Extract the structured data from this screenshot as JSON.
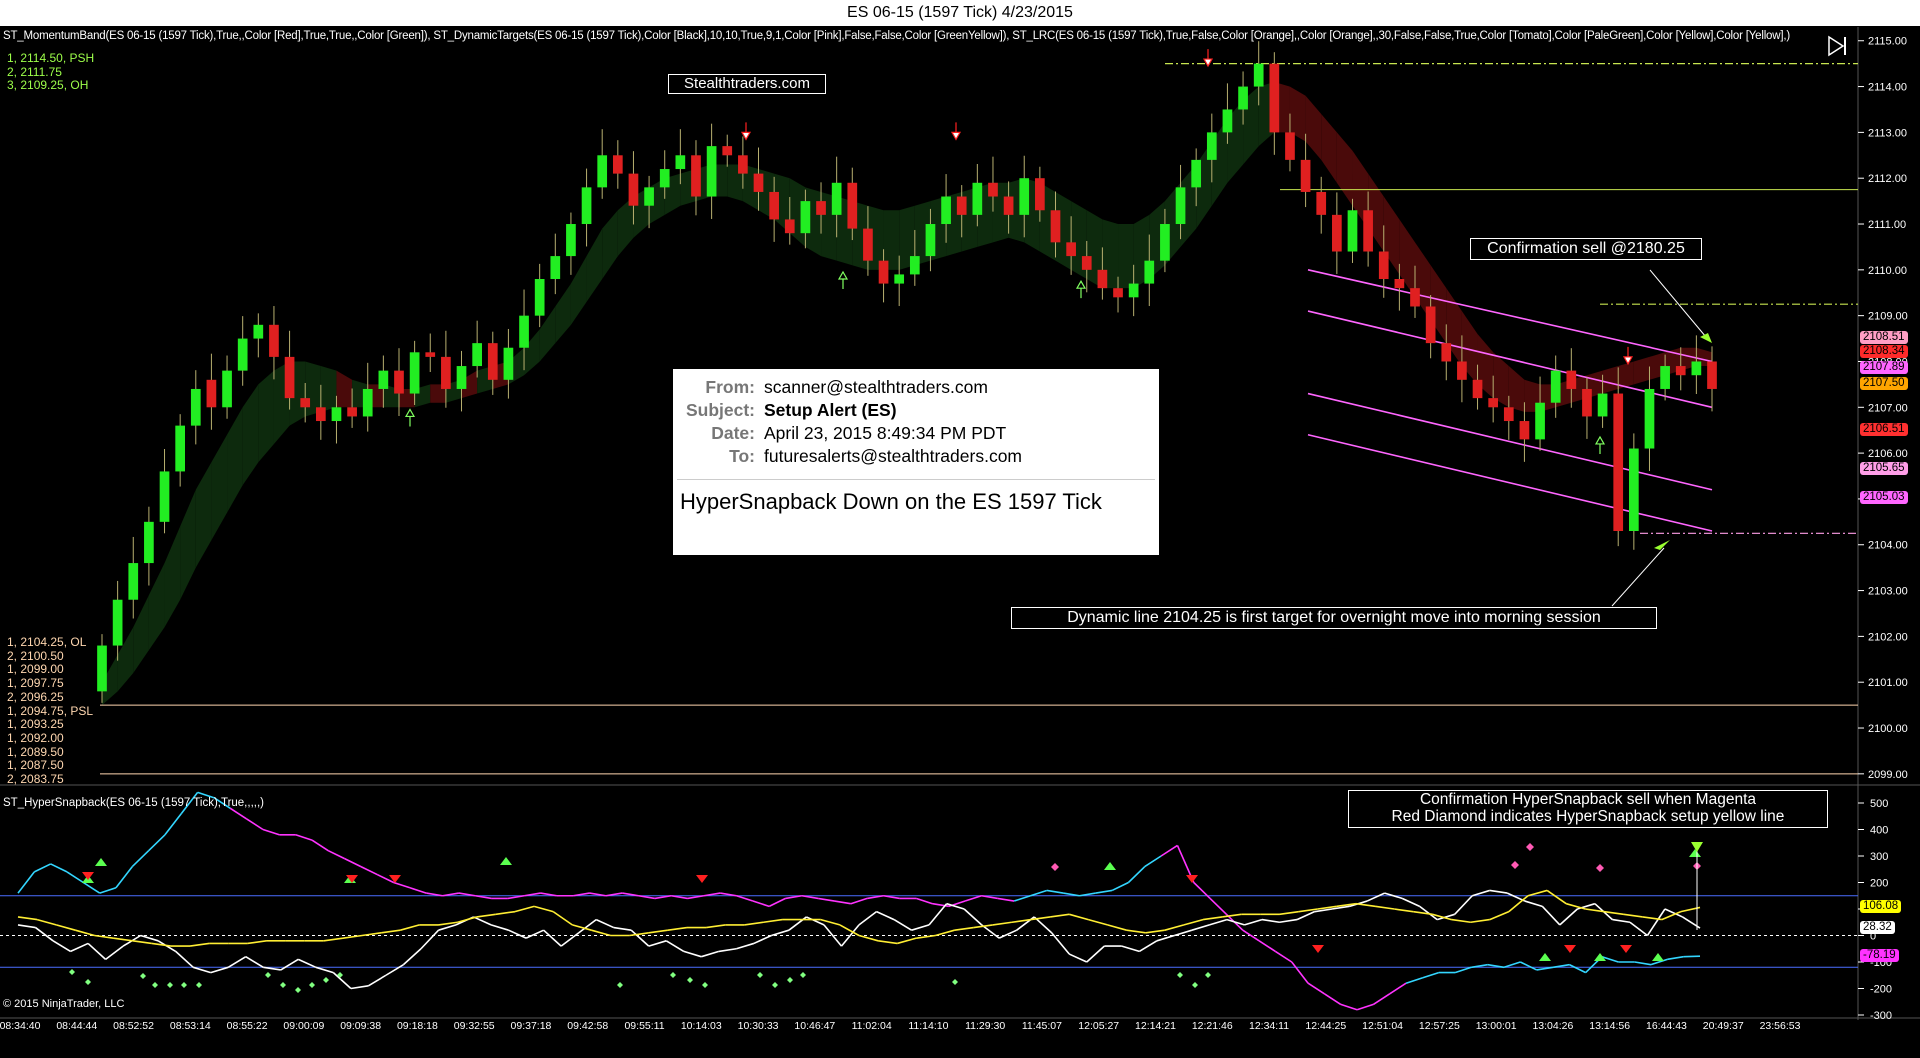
{
  "window": {
    "title": "ES 06-15 (1597 Tick)  4/23/2015"
  },
  "indicators_text": "ST_MomentumBand(ES 06-15 (1597 Tick),True,,Color [Red],True,True,,Color [Green]), ST_DynamicTargets(ES 06-15 (1597 Tick),Color [Black],10,10,True,9,1,Color [Pink],False,False,Color [GreenYellow]), ST_LRC(ES 06-15 (1597 Tick),True,False,Color [Orange],,Color [Orange],,30,False,False,True,Color [Tomato],Color [PaleGreen],Color [Yellow],Color [Yellow],)",
  "lower_indicator_text": "ST_HyperSnapback(ES 06-15 (1597 Tick),True,,,,,)",
  "copyright": "© 2015 NinjaTrader, LLC",
  "levels_top": [
    {
      "text": "1, 2114.50, PSH",
      "color": "#9dff4a"
    },
    {
      "text": "2, 2111.75",
      "color": "#9dff4a"
    },
    {
      "text": "3, 2109.25, OH",
      "color": "#9dff4a"
    }
  ],
  "levels_bottom": [
    {
      "text": "1, 2104.25, OL",
      "color": "#ffd7b0"
    },
    {
      "text": "2, 2100.50",
      "color": "#ffd7b0"
    },
    {
      "text": "1, 2099.00",
      "color": "#ffd7b0"
    },
    {
      "text": "1, 2097.75",
      "color": "#ffd7b0"
    },
    {
      "text": "2, 2096.25",
      "color": "#ffd7b0"
    },
    {
      "text": "1, 2094.75, PSL",
      "color": "#ffd7b0"
    },
    {
      "text": "1, 2093.25",
      "color": "#ffd7b0"
    },
    {
      "text": "1, 2092.00",
      "color": "#ffd7b0"
    },
    {
      "text": "1, 2089.50",
      "color": "#ffd7b0"
    },
    {
      "text": "1, 2087.50",
      "color": "#ffd7b0"
    },
    {
      "text": "2, 2083.75",
      "color": "#ffd7b0"
    }
  ],
  "annotations": {
    "brand": "Stealthtraders.com",
    "confirmation_sell": "Confirmation sell @2180.25",
    "dynamic_line": "Dynamic  line  2104.25  is first target for overnight move into morning session",
    "hypersnap_note_1": "Confirmation HyperSnapback sell when Magenta",
    "hypersnap_note_2": "Red Diamond indicates HyperSnapback setup yellow line"
  },
  "email": {
    "from_label": "From:",
    "from": "scanner@stealthtraders.com",
    "subject_label": "Subject:",
    "subject": "Setup Alert (ES)",
    "date_label": "Date:",
    "date": "April 23, 2015 8:49:34 PM PDT",
    "to_label": "To:",
    "to": "futuresalerts@stealthtraders.com",
    "body": "HyperSnapback Down on the ES 1597 Tick"
  },
  "price_tags": [
    {
      "text": "2108.51",
      "color": "#ff9ec4",
      "price": 2108.51
    },
    {
      "text": "2108.34",
      "color": "#ff2a2a",
      "price": 2108.2
    },
    {
      "text": "2107.89",
      "color": "#ff66ff",
      "price": 2107.85
    },
    {
      "text": "2107.50",
      "color": "#ffa500",
      "price": 2107.5
    },
    {
      "text": "2106.51",
      "color": "#ff3030",
      "price": 2106.51
    },
    {
      "text": "2105.65",
      "color": "#ff9ee8",
      "price": 2105.65
    },
    {
      "text": "2105.03",
      "color": "#ff66ff",
      "price": 2105.03
    }
  ],
  "osc_tags": [
    {
      "text": "106.08",
      "color": "#ffff00",
      "value": 106.08
    },
    {
      "text": "28.32",
      "color": "#ffffff",
      "value": 28.32
    },
    {
      "text": "-78.19",
      "color": "#ff33ff",
      "value": -78.19
    }
  ],
  "chart_data": {
    "type": "candlestick",
    "title": "ES 06-15 (1597 Tick)  4/23/2015",
    "price_axis": {
      "ylim": [
        2098.8,
        2115.3
      ],
      "ticks": [
        2099,
        2100,
        2101,
        2102,
        2103,
        2104,
        2105,
        2106,
        2107,
        2108,
        2109,
        2110,
        2111,
        2112,
        2113,
        2114,
        2115
      ],
      "tick_labels": [
        "2099.00",
        "2100.00",
        "2101.00",
        "2102.00",
        "2103.00",
        "2104.00",
        "2105.00",
        "2106.00",
        "2107.00",
        "2108.00",
        "2109.00",
        "2110.00",
        "2111.00",
        "2112.00",
        "2113.00",
        "2114.00",
        "2115.00"
      ]
    },
    "time_labels": [
      "08:34:40",
      "08:44:44",
      "08:52:52",
      "08:53:14",
      "08:55:22",
      "09:00:09",
      "09:09:38",
      "09:18:18",
      "09:32:55",
      "09:37:18",
      "09:42:58",
      "09:55:11",
      "10:14:03",
      "10:30:33",
      "10:46:47",
      "11:02:04",
      "11:14:10",
      "11:29:30",
      "11:45:07",
      "12:05:27",
      "12:14:21",
      "12:21:46",
      "12:34:11",
      "12:44:25",
      "12:51:04",
      "12:57:25",
      "13:00:01",
      "13:04:26",
      "13:14:56",
      "16:44:43",
      "20:49:37",
      "23:56:53"
    ],
    "closes": [
      2101.8,
      2102.8,
      2103.6,
      2104.5,
      2105.6,
      2106.6,
      2107.4,
      2107.0,
      2107.8,
      2108.5,
      2108.8,
      2108.1,
      2107.2,
      2107.0,
      2106.7,
      2107.0,
      2106.8,
      2107.4,
      2107.8,
      2107.3,
      2108.2,
      2108.1,
      2107.4,
      2107.9,
      2108.4,
      2107.6,
      2108.3,
      2109.0,
      2109.8,
      2110.3,
      2111.0,
      2111.8,
      2112.5,
      2112.1,
      2111.4,
      2111.8,
      2112.2,
      2112.5,
      2111.6,
      2112.7,
      2112.5,
      2112.1,
      2111.7,
      2111.1,
      2110.8,
      2111.5,
      2111.2,
      2111.9,
      2110.9,
      2110.2,
      2109.7,
      2109.9,
      2110.3,
      2111.0,
      2111.6,
      2111.2,
      2111.9,
      2111.6,
      2111.2,
      2112.0,
      2111.3,
      2110.6,
      2110.3,
      2110.0,
      2109.6,
      2109.4,
      2109.7,
      2110.2,
      2111.0,
      2111.8,
      2112.4,
      2113.0,
      2113.5,
      2114.0,
      2114.5,
      2113.0,
      2112.4,
      2111.7,
      2111.2,
      2110.4,
      2111.3,
      2110.4,
      2109.8,
      2109.6,
      2109.2,
      2108.4,
      2108.0,
      2107.6,
      2107.2,
      2107.0,
      2106.7,
      2106.3,
      2107.1,
      2107.8,
      2107.4,
      2106.8,
      2107.3,
      2104.3,
      2106.1,
      2107.4,
      2107.9,
      2107.7,
      2108.0,
      2107.4
    ],
    "opens": [
      2100.8,
      2101.8,
      2102.8,
      2103.6,
      2104.5,
      2105.6,
      2106.6,
      2107.6,
      2107.0,
      2107.8,
      2108.5,
      2108.8,
      2108.1,
      2107.2,
      2107.0,
      2106.7,
      2107.0,
      2106.8,
      2107.4,
      2107.8,
      2107.3,
      2108.2,
      2108.1,
      2107.4,
      2107.9,
      2108.4,
      2107.6,
      2108.3,
      2109.0,
      2109.8,
      2110.3,
      2111.0,
      2111.8,
      2112.5,
      2112.1,
      2111.4,
      2111.8,
      2112.2,
      2112.5,
      2111.6,
      2112.7,
      2112.5,
      2112.1,
      2111.7,
      2111.1,
      2110.8,
      2111.5,
      2111.2,
      2111.9,
      2110.9,
      2110.2,
      2109.7,
      2109.9,
      2110.3,
      2111.0,
      2111.6,
      2111.2,
      2111.9,
      2111.6,
      2111.2,
      2112.0,
      2111.3,
      2110.6,
      2110.3,
      2110.0,
      2109.6,
      2109.4,
      2109.7,
      2110.2,
      2111.0,
      2111.8,
      2112.4,
      2113.0,
      2113.5,
      2114.0,
      2114.5,
      2113.0,
      2112.4,
      2111.7,
      2111.2,
      2110.4,
      2111.3,
      2110.4,
      2109.8,
      2109.6,
      2109.2,
      2108.4,
      2108.0,
      2107.6,
      2107.2,
      2107.0,
      2106.7,
      2106.3,
      2107.1,
      2107.8,
      2107.4,
      2106.8,
      2107.3,
      2104.3,
      2106.1,
      2107.4,
      2107.9,
      2107.7,
      2108.0
    ],
    "upper_band": [
      2101.0,
      2101.6,
      2102.2,
      2102.9,
      2103.6,
      2104.4,
      2105.2,
      2105.8,
      2106.4,
      2107.0,
      2107.5,
      2107.8,
      2108.0,
      2108.0,
      2107.9,
      2107.8,
      2107.6,
      2107.5,
      2107.5,
      2107.4,
      2107.4,
      2107.5,
      2107.5,
      2107.6,
      2107.8,
      2107.9,
      2108.0,
      2108.3,
      2108.7,
      2109.2,
      2109.7,
      2110.3,
      2110.9,
      2111.3,
      2111.6,
      2111.8,
      2112.0,
      2112.1,
      2112.2,
      2112.3,
      2112.3,
      2112.3,
      2112.2,
      2112.1,
      2112.0,
      2111.8,
      2111.7,
      2111.6,
      2111.5,
      2111.4,
      2111.3,
      2111.3,
      2111.4,
      2111.5,
      2111.6,
      2111.7,
      2111.8,
      2111.9,
      2111.9,
      2112.0,
      2111.9,
      2111.7,
      2111.5,
      2111.3,
      2111.1,
      2111.0,
      2111.0,
      2111.2,
      2111.5,
      2111.9,
      2112.3,
      2112.8,
      2113.3,
      2113.7,
      2114.0,
      2114.1,
      2114.0,
      2113.8,
      2113.4,
      2113.0,
      2112.6,
      2112.1,
      2111.6,
      2111.1,
      2110.6,
      2110.1,
      2109.6,
      2109.1,
      2108.6,
      2108.2,
      2107.9,
      2107.6,
      2107.5,
      2107.5,
      2107.6,
      2107.7,
      2107.8,
      2107.9,
      2108.0,
      2108.1,
      2108.2,
      2108.3,
      2108.3,
      2108.2
    ],
    "lower_band": [
      2100.5,
      2100.8,
      2101.2,
      2101.7,
      2102.2,
      2102.8,
      2103.5,
      2104.1,
      2104.7,
      2105.3,
      2105.8,
      2106.2,
      2106.6,
      2106.8,
      2106.9,
      2107.0,
      2107.0,
      2107.0,
      2107.0,
      2107.0,
      2107.0,
      2107.1,
      2107.1,
      2107.2,
      2107.3,
      2107.4,
      2107.5,
      2107.7,
      2108.0,
      2108.4,
      2108.8,
      2109.3,
      2109.8,
      2110.3,
      2110.7,
      2111.0,
      2111.2,
      2111.4,
      2111.5,
      2111.6,
      2111.6,
      2111.5,
      2111.3,
      2111.1,
      2110.8,
      2110.5,
      2110.3,
      2110.2,
      2110.1,
      2110.0,
      2110.0,
      2110.0,
      2110.1,
      2110.2,
      2110.3,
      2110.4,
      2110.5,
      2110.6,
      2110.7,
      2110.6,
      2110.4,
      2110.2,
      2110.0,
      2109.8,
      2109.6,
      2109.6,
      2109.6,
      2109.8,
      2110.1,
      2110.5,
      2110.9,
      2111.4,
      2111.9,
      2112.3,
      2112.7,
      2113.0,
      2113.0,
      2112.8,
      2112.4,
      2111.9,
      2111.4,
      2110.9,
      2110.4,
      2109.9,
      2109.4,
      2108.9,
      2108.4,
      2107.9,
      2107.5,
      2107.2,
      2107.0,
      2106.9,
      2106.9,
      2107.0,
      2107.1,
      2107.2,
      2107.3,
      2107.4,
      2107.5,
      2107.6,
      2107.7,
      2107.8,
      2107.9,
      2107.9
    ],
    "oscillator": {
      "yticks": [
        500,
        400,
        300,
        200,
        100,
        0,
        -100,
        -200,
        -300
      ],
      "cyan_magenta": [
        160,
        240,
        270,
        240,
        200,
        160,
        180,
        260,
        320,
        380,
        460,
        540,
        520,
        480,
        440,
        400,
        380,
        380,
        360,
        320,
        290,
        260,
        230,
        200,
        180,
        160,
        150,
        160,
        150,
        140,
        140,
        150,
        160,
        150,
        150,
        160,
        150,
        160,
        150,
        140,
        150,
        140,
        150,
        160,
        150,
        130,
        110,
        140,
        150,
        140,
        130,
        120,
        140,
        150,
        140,
        140,
        120,
        110,
        130,
        150,
        140,
        130,
        150,
        170,
        160,
        150,
        160,
        170,
        200,
        260,
        300,
        340,
        200,
        140,
        80,
        20,
        -20,
        -60,
        -100,
        -180,
        -220,
        -260,
        -280,
        -260,
        -220,
        -180,
        -160,
        -140,
        -140,
        -120,
        -110,
        -120,
        -100,
        -130,
        -120,
        -110,
        -140,
        -80,
        -100,
        -100,
        -110,
        -90,
        -80,
        -78
      ],
      "white": [
        40,
        30,
        -20,
        -60,
        -30,
        -90,
        -40,
        0,
        -20,
        -60,
        -120,
        -140,
        -120,
        -80,
        -120,
        -130,
        -90,
        -120,
        -140,
        -200,
        -190,
        -150,
        -110,
        -50,
        20,
        40,
        70,
        40,
        20,
        -10,
        20,
        -40,
        10,
        60,
        30,
        20,
        -40,
        -20,
        -60,
        -80,
        -60,
        -50,
        -30,
        0,
        20,
        70,
        40,
        -40,
        40,
        90,
        60,
        20,
        40,
        120,
        100,
        40,
        -10,
        20,
        70,
        10,
        -70,
        -100,
        -40,
        -40,
        -60,
        -20,
        0,
        20,
        40,
        60,
        40,
        60,
        50,
        60,
        90,
        100,
        110,
        130,
        160,
        140,
        110,
        60,
        80,
        150,
        170,
        160,
        130,
        110,
        40,
        100,
        120,
        60,
        50,
        0,
        100,
        70,
        28
      ],
      "yellow": [
        70,
        60,
        40,
        20,
        0,
        -10,
        -20,
        -30,
        -40,
        -40,
        -30,
        -30,
        -30,
        -20,
        -20,
        -20,
        -20,
        -10,
        0,
        10,
        20,
        40,
        40,
        50,
        70,
        80,
        90,
        110,
        90,
        40,
        20,
        0,
        0,
        10,
        20,
        30,
        30,
        40,
        40,
        50,
        60,
        60,
        60,
        40,
        0,
        -20,
        -30,
        -10,
        0,
        20,
        30,
        40,
        50,
        60,
        70,
        80,
        60,
        40,
        20,
        10,
        20,
        40,
        60,
        70,
        80,
        80,
        80,
        90,
        100,
        110,
        120,
        110,
        100,
        90,
        80,
        60,
        50,
        60,
        90,
        150,
        170,
        120,
        100,
        90,
        80,
        70,
        60,
        90,
        106
      ],
      "levels": [
        150,
        0,
        -120
      ]
    }
  }
}
